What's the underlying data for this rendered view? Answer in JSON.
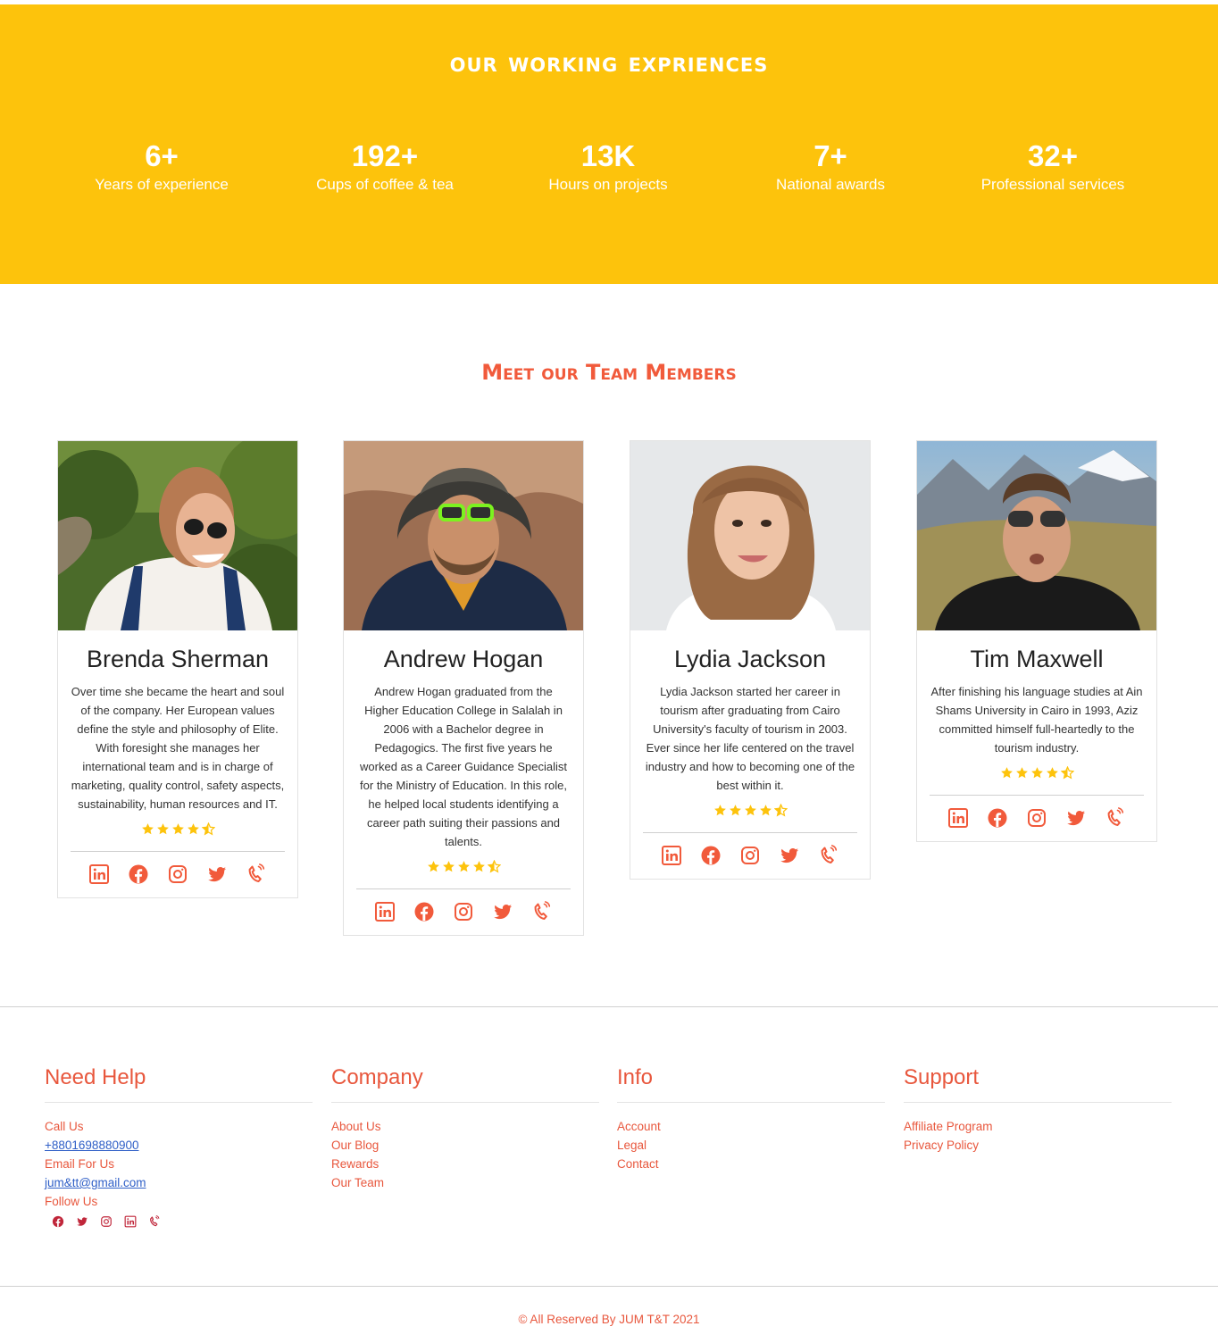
{
  "stats": {
    "title": "our working expriences",
    "items": [
      {
        "value": "6+",
        "label": "Years of experience"
      },
      {
        "value": "192+",
        "label": "Cups of coffee & tea"
      },
      {
        "value": "13K",
        "label": "Hours on projects"
      },
      {
        "value": "7+",
        "label": "National awards"
      },
      {
        "value": "32+",
        "label": "Professional services"
      }
    ]
  },
  "team": {
    "title": "Meet our Team Members",
    "members": [
      {
        "name": "Brenda Sherman",
        "bio": "Over time she became the heart and soul of the company. Her European values define the style and philosophy of Elite. With foresight she manages her international team and is in charge of marketing, quality control, safety aspects, sustainability, human resources and IT.",
        "rating": 4.5
      },
      {
        "name": "Andrew Hogan",
        "bio": "Andrew Hogan graduated from the Higher Education College in Salalah in 2006 with a Bachelor degree in Pedagogics. The first five years he worked as a Career Guidance Specialist for the Ministry of Education. In this role, he helped local students identifying a career path suiting their passions and talents.",
        "rating": 4.5
      },
      {
        "name": "Lydia Jackson",
        "bio": "Lydia Jackson started her career in tourism after graduating from Cairo University's faculty of tourism in 2003. Ever since her life centered on the travel industry and how to becoming one of the best within it.",
        "rating": 4.5
      },
      {
        "name": "Tim Maxwell",
        "bio": "After finishing his language studies at Ain Shams University in Cairo in 1993, Aziz committed himself full-heartedly to the tourism industry.",
        "rating": 4.5
      }
    ],
    "social_icons": [
      "linkedin-icon",
      "facebook-icon",
      "instagram-icon",
      "twitter-icon",
      "phone-icon"
    ]
  },
  "footer": {
    "need_help": {
      "title": "Need Help",
      "call_label": "Call Us",
      "phone": "+8801698880900",
      "email_label": "Email For Us",
      "email": "jum&tt@gmail.com",
      "follow_label": "Follow Us"
    },
    "company": {
      "title": "Company",
      "links": [
        "About Us",
        "Our Blog",
        "Rewards",
        "Our Team"
      ]
    },
    "info": {
      "title": "Info",
      "links": [
        "Account",
        "Legal",
        "Contact"
      ]
    },
    "support": {
      "title": "Support",
      "links": [
        "Affiliate Program",
        "Privacy Policy"
      ]
    },
    "copyright": "© All Reserved By JUM T&T 2021"
  },
  "colors": {
    "accent": "#f15a3b",
    "banner": "#fdc30c",
    "star": "#fdc30c",
    "footer_icon": "#c0263a"
  }
}
